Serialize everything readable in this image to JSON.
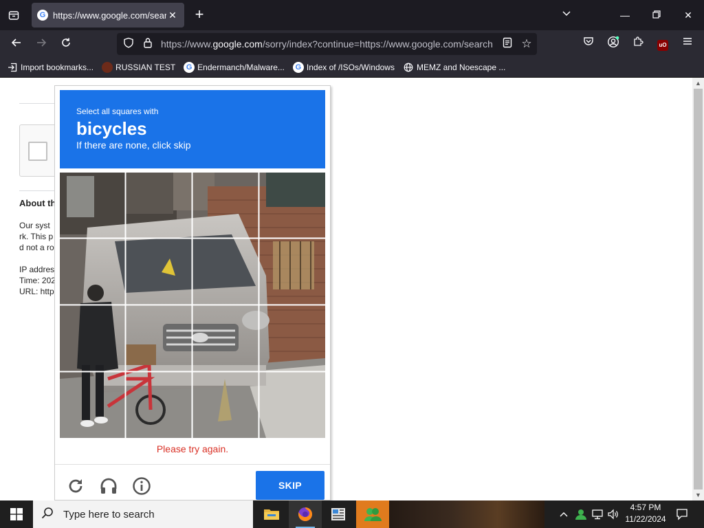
{
  "browser": {
    "tab_title": "https://www.google.com/searc",
    "url_prefix": "https://www.",
    "url_domain": "google.com",
    "url_rest": "/sorry/index?continue=https://www.google.com/search"
  },
  "bookmarks": [
    {
      "label": "Import bookmarks...",
      "icon": "import-icon"
    },
    {
      "label": "RUSSIAN TEST",
      "icon": "site-icon"
    },
    {
      "label": "Endermanch/Malware...",
      "icon": "google-icon"
    },
    {
      "label": "Index of /ISOs/Windows",
      "icon": "google-icon"
    },
    {
      "label": "MEMZ and Noescape ...",
      "icon": "globe-icon"
    }
  ],
  "page": {
    "about_heading": "About th",
    "body_lines": [
      "Our syst",
      "rk. This p",
      "d not a ro"
    ],
    "ip_label": "IP addres",
    "time_label": "Time: 202",
    "url_label": "URL: http"
  },
  "captcha": {
    "instruction_small": "Select all squares with",
    "target": "bicycles",
    "instruction_sub": "If there are none, click skip",
    "error": "Please try again.",
    "skip_label": "SKIP",
    "grid_size": 4
  },
  "taskbar": {
    "search_placeholder": "Type here to search",
    "time": "4:57 PM",
    "date": "11/22/2024"
  },
  "colors": {
    "captcha_blue": "#1a73e8",
    "error_red": "#d93025",
    "browser_dark": "#1c1b22",
    "toolbar": "#2b2a33"
  }
}
